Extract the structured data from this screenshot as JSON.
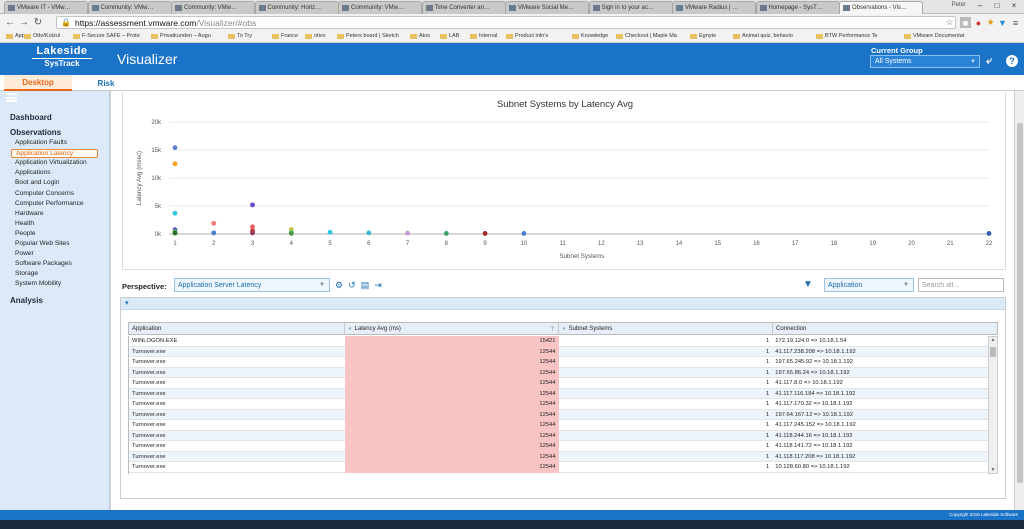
{
  "browser": {
    "tabs": [
      {
        "label": "VMware IT - VMw…",
        "active": false
      },
      {
        "label": "Community: VMw…",
        "active": false
      },
      {
        "label": "Community: VMw…",
        "active": false
      },
      {
        "label": "Community: Horiz…",
        "active": false
      },
      {
        "label": "Community: VMw…",
        "active": false
      },
      {
        "label": "Time Converter an…",
        "active": false
      },
      {
        "label": "VMware Social Me…",
        "active": false
      },
      {
        "label": "Sign in to your ac…",
        "active": false
      },
      {
        "label": "VMware Radius | …",
        "active": false
      },
      {
        "label": "Homepage - SysT…",
        "active": false
      },
      {
        "label": "Observations - Vis…",
        "active": true
      }
    ],
    "user": "Peter",
    "url_domain": "https://assessment.vmware.com",
    "url_path": "/Visualizer/#obs",
    "bookmarks": [
      "Apps",
      "Otto/Kotzul",
      "F-Secure SAFE – Prote",
      "Privatkunden – Augu",
      "To Try",
      "France",
      "otivo",
      "Peters board | Sketch",
      "Atos",
      "LAB",
      "Internal",
      "Product info's",
      "Knowledge",
      "Checkout | Maple Ma",
      "Egnyte",
      "Animal quiz, behavio",
      "BTW Performance Te",
      "VMware Documentat"
    ]
  },
  "header": {
    "logo_top": "Lakeside",
    "logo_bottom": "SysTrack",
    "title": "Visualizer",
    "current_group_label": "Current Group",
    "current_group_value": "All Systems"
  },
  "subtabs": [
    {
      "label": "Desktop",
      "active": true
    },
    {
      "label": "Risk",
      "active": false
    }
  ],
  "sidebar": {
    "dashboard": "Dashboard",
    "observations": "Observations",
    "analysis": "Analysis",
    "items": [
      "Application Faults",
      "Application Latency",
      "Application Virtualization",
      "Applications",
      "Boot and Login",
      "Computer Concerns",
      "Computer Performance",
      "Hardware",
      "Health",
      "People",
      "Popular Web Sites",
      "Power",
      "Software Packages",
      "Storage",
      "System Mobility"
    ],
    "selected_index": 1
  },
  "chart_data": {
    "type": "scatter",
    "title": "Subnet Systems by Latency Avg",
    "xlabel": "Subnet Systems",
    "ylabel": "Latency Avg (msec)",
    "ylim": [
      0,
      20000
    ],
    "yticks": [
      "0k",
      "5k",
      "10k",
      "15k",
      "20k"
    ],
    "xticks": [
      1,
      2,
      3,
      4,
      5,
      6,
      7,
      8,
      9,
      10,
      11,
      12,
      13,
      14,
      15,
      16,
      17,
      18,
      19,
      20,
      21,
      22
    ],
    "grid": true,
    "points": [
      {
        "x": 1,
        "y": 15421,
        "color": "#5b7fd6"
      },
      {
        "x": 1,
        "y": 12544,
        "color": "#f5a11c"
      },
      {
        "x": 1,
        "y": 3700,
        "color": "#2ec7e0"
      },
      {
        "x": 1,
        "y": 800,
        "color": "#6a5acd"
      },
      {
        "x": 1,
        "y": 400,
        "color": "#4caf50"
      },
      {
        "x": 1,
        "y": 150,
        "color": "#2a6f2a"
      },
      {
        "x": 2,
        "y": 1900,
        "color": "#f07a7a"
      },
      {
        "x": 2,
        "y": 200,
        "color": "#4a7fd0"
      },
      {
        "x": 3,
        "y": 5200,
        "color": "#6a4cc8"
      },
      {
        "x": 3,
        "y": 1300,
        "color": "#e86060"
      },
      {
        "x": 3,
        "y": 600,
        "color": "#d13c3c"
      },
      {
        "x": 3,
        "y": 200,
        "color": "#9b3a5a"
      },
      {
        "x": 4,
        "y": 800,
        "color": "#c8c040"
      },
      {
        "x": 4,
        "y": 300,
        "color": "#6ad06a"
      },
      {
        "x": 4,
        "y": 100,
        "color": "#4a9a4a"
      },
      {
        "x": 5,
        "y": 300,
        "color": "#2ec7e0"
      },
      {
        "x": 6,
        "y": 200,
        "color": "#40b8d8"
      },
      {
        "x": 7,
        "y": 150,
        "color": "#c09ad8"
      },
      {
        "x": 8,
        "y": 100,
        "color": "#3aa060"
      },
      {
        "x": 9,
        "y": 100,
        "color": "#a02828"
      },
      {
        "x": 10,
        "y": 100,
        "color": "#4a7fd0"
      },
      {
        "x": 22,
        "y": 100,
        "color": "#2f5fb0"
      }
    ]
  },
  "toolbar": {
    "perspective_label": "Perspective:",
    "perspective_value": "Application Server Latency",
    "filter_value": "Application",
    "search_placeholder": "Search all..."
  },
  "grid": {
    "columns": [
      "Application",
      "Latency Avg (ms)",
      "Subnet Systems",
      "Connection"
    ],
    "rows": [
      [
        "WINLOGON.EXE",
        "15421",
        "1",
        "172.19.124.0 => 10.18.1.54"
      ],
      [
        "Turnover.exe",
        "12544",
        "1",
        "41.117.238.208 => 10.18.1.192"
      ],
      [
        "Turnover.exe",
        "12544",
        "1",
        "197.65.245.92 => 10.18.1.192"
      ],
      [
        "Turnover.exe",
        "12544",
        "1",
        "197.65.86.24 => 10.18.1.192"
      ],
      [
        "Turnover.exe",
        "12544",
        "1",
        "41.117.8.0 => 10.18.1.192"
      ],
      [
        "Turnover.exe",
        "12544",
        "1",
        "41.117.116.184 => 10.18.1.192"
      ],
      [
        "Turnover.exe",
        "12544",
        "1",
        "41.117.170.32 => 10.18.1.192"
      ],
      [
        "Turnover.exe",
        "12544",
        "1",
        "197.64.167.12 => 10.18.1.192"
      ],
      [
        "Turnover.exe",
        "12544",
        "1",
        "41.117.245.152 => 10.18.1.192"
      ],
      [
        "Turnover.exe",
        "12544",
        "1",
        "41.118.244.16 => 10.18.1.192"
      ],
      [
        "Turnover.exe",
        "12544",
        "1",
        "41.118.141.72 => 10.18.1.192"
      ],
      [
        "Turnover.exe",
        "12544",
        "1",
        "41.118.117.208 => 10.18.1.192"
      ],
      [
        "Turnover.exe",
        "12544",
        "1",
        "10.128.60.80 => 10.18.1.192"
      ]
    ]
  },
  "footer": {
    "copyright": "Copyright 2016 Lakeside Software"
  }
}
